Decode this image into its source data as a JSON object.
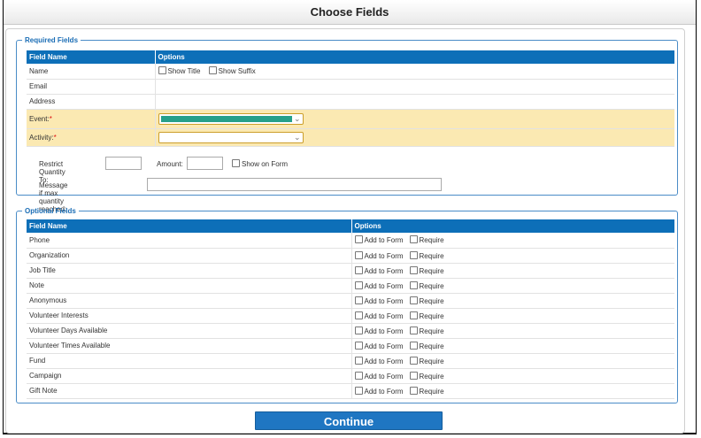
{
  "page": {
    "title": "Choose Fields"
  },
  "required": {
    "legend": "Required Fields",
    "headers": [
      "Field Name",
      "Options"
    ],
    "rows": [
      {
        "name": "Name",
        "options": [
          "Show Title",
          "Show Suffix"
        ]
      },
      {
        "name": "Email"
      },
      {
        "name": "Address"
      },
      {
        "name": "Event:",
        "required": true,
        "select_color": "#26a08b"
      },
      {
        "name": "Activity:",
        "required": true
      }
    ],
    "restrict_quantity_label": "Restrict Quantity To:",
    "amount_label": "Amount:",
    "show_on_form_label": "Show on Form",
    "max_message_label": "Message if max quantity reached:"
  },
  "optional": {
    "legend": "Optional Fields",
    "headers": [
      "Field Name",
      "Options"
    ],
    "option_labels": [
      "Add to Form",
      "Require"
    ],
    "rows": [
      "Phone",
      "Organization",
      "Job Title",
      "Note",
      "Anonymous",
      "Volunteer Interests",
      "Volunteer Days Available",
      "Volunteer Times Available",
      "Fund",
      "Campaign",
      "Gift Note"
    ]
  },
  "continue_label": "Continue",
  "colors": {
    "header_blue": "#0d6fb8",
    "legend_blue": "#1a6db5",
    "highlight": "#fbe9b2",
    "continue_bg": "#1f76c2"
  }
}
